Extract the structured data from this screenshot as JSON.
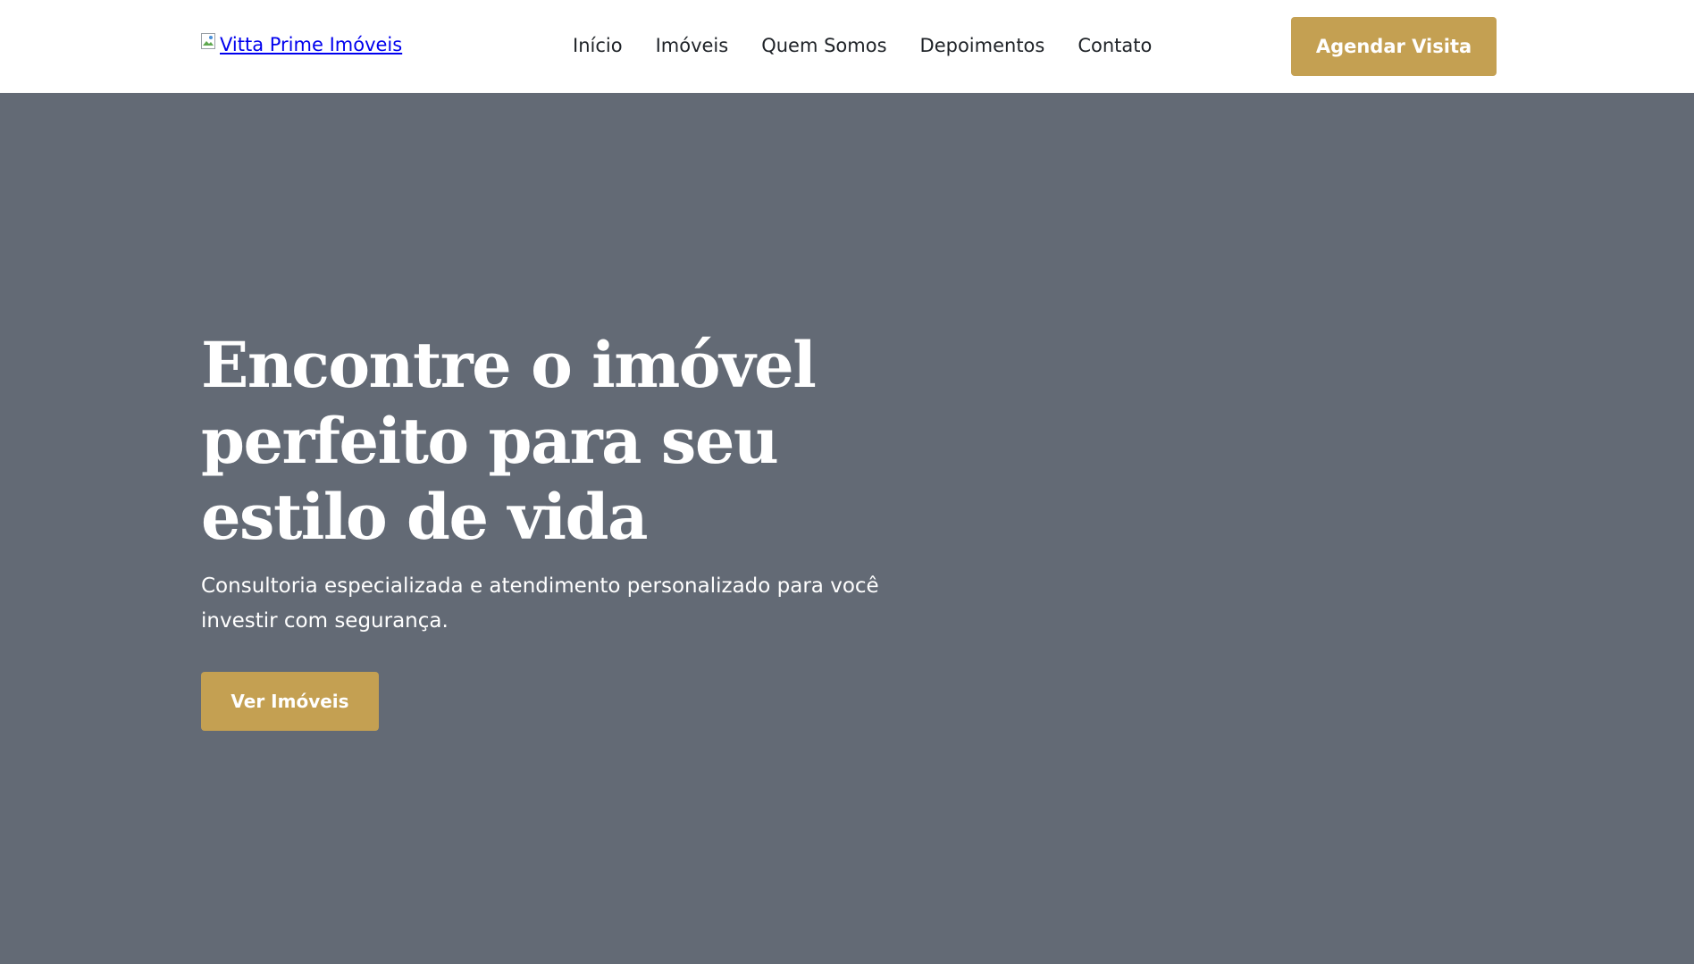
{
  "header": {
    "logo_alt": "Vitta Prime Imóveis",
    "nav": [
      {
        "label": "Início"
      },
      {
        "label": "Imóveis"
      },
      {
        "label": "Quem Somos"
      },
      {
        "label": "Depoimentos"
      },
      {
        "label": "Contato"
      }
    ],
    "cta_label": "Agendar Visita"
  },
  "hero": {
    "title": "Encontre o imóvel perfeito para seu estilo de vida",
    "subtitle": "Consultoria especializada e atendimento personalizado para você investir com segurança.",
    "cta_label": "Ver Imóveis"
  },
  "colors": {
    "accent": "#c4a052",
    "hero_background": "#636a75",
    "header_background": "#ffffff",
    "nav_text": "#1f2328",
    "link": "#0000ee"
  },
  "icons": {
    "logo": "broken-image-icon"
  }
}
